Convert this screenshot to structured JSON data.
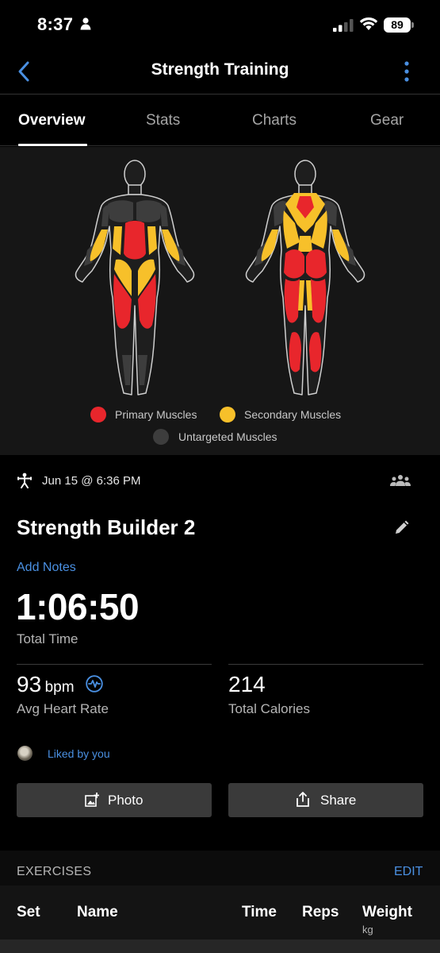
{
  "status_bar": {
    "time": "8:37",
    "battery": "89",
    "icons": [
      "person-icon",
      "signal-icon",
      "wifi-icon",
      "battery-icon"
    ]
  },
  "nav": {
    "title": "Strength Training",
    "back_icon": "chevron-left-icon",
    "more_icon": "more-vertical-icon"
  },
  "tabs": [
    {
      "label": "Overview",
      "active": true
    },
    {
      "label": "Stats",
      "active": false
    },
    {
      "label": "Charts",
      "active": false
    },
    {
      "label": "Gear",
      "active": false
    }
  ],
  "muscle_map": {
    "legend": {
      "primary": "Primary Muscles",
      "secondary": "Secondary Muscles",
      "untargeted": "Untargeted Muscles"
    },
    "colors": {
      "primary": "#e8262c",
      "secondary": "#f7c02a",
      "untargeted": "#3d3d3d"
    }
  },
  "workout": {
    "datetime": "Jun 15 @ 6:36 PM",
    "title": "Strength Builder 2",
    "add_notes": "Add Notes",
    "total_time": "1:06:50",
    "total_time_label": "Total Time",
    "heart_rate": {
      "value": "93",
      "unit": "bpm",
      "label": "Avg Heart Rate"
    },
    "calories": {
      "value": "214",
      "label": "Total Calories"
    },
    "liked": "Liked by you"
  },
  "buttons": {
    "photo": "Photo",
    "share": "Share"
  },
  "exercises": {
    "title": "EXERCISES",
    "edit": "EDIT",
    "columns": {
      "set": "Set",
      "name": "Name",
      "time": "Time",
      "reps": "Reps",
      "weight": "Weight",
      "weight_unit": "kg"
    }
  },
  "colors": {
    "accent": "#4a90e2",
    "background": "#000000",
    "panel": "#161616"
  }
}
